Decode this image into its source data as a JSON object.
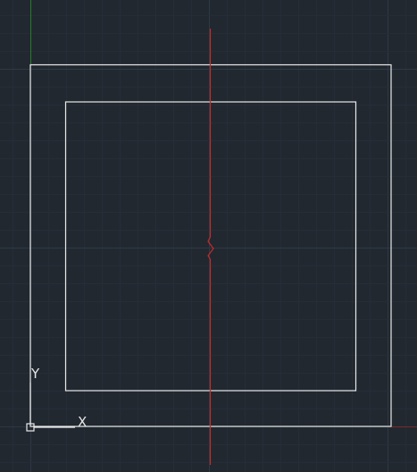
{
  "ucs_icon": {
    "x_label": "X",
    "y_label": "Y"
  },
  "colors": {
    "background": "#212830",
    "grid_minor": "#262d37",
    "grid_major": "#2f3844",
    "geometry": "#e8e8e8",
    "section_line": "#c42a2a",
    "axis_x": "#7a2a2a",
    "axis_y": "#2a7a2a"
  }
}
